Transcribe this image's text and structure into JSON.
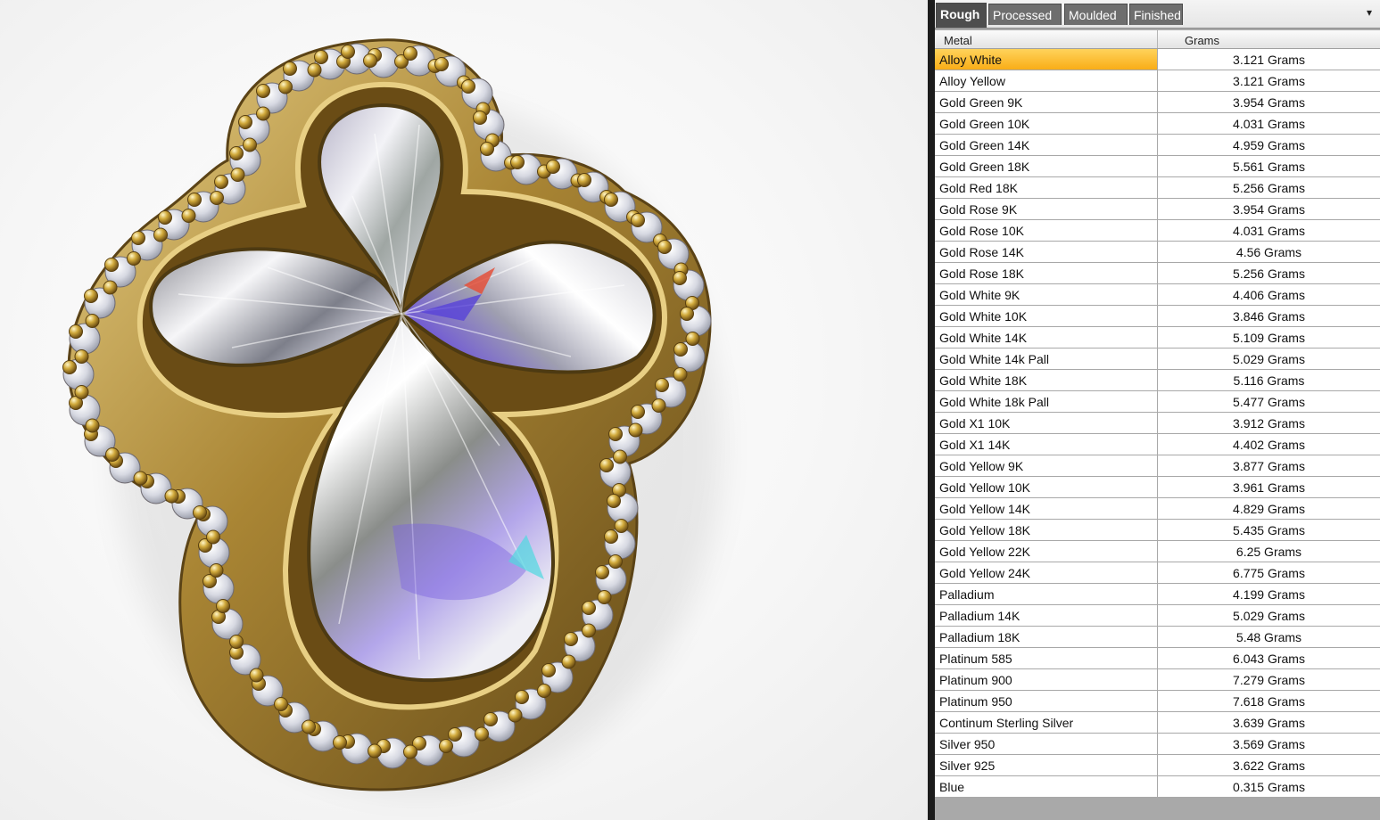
{
  "tabs": [
    {
      "label": "Rough",
      "active": true
    },
    {
      "label": "Processed",
      "active": false
    },
    {
      "label": "Moulded",
      "active": false
    },
    {
      "label": "Finished",
      "active": false
    }
  ],
  "dropdown_icon": "▾",
  "table": {
    "columns": [
      "Metal",
      "Grams"
    ],
    "selected_row": 0,
    "rows": [
      {
        "metal": "Alloy White",
        "grams": "3.121 Grams"
      },
      {
        "metal": "Alloy Yellow",
        "grams": "3.121 Grams"
      },
      {
        "metal": "Gold Green 9K",
        "grams": "3.954 Grams"
      },
      {
        "metal": "Gold Green 10K",
        "grams": "4.031 Grams"
      },
      {
        "metal": "Gold Green 14K",
        "grams": "4.959 Grams"
      },
      {
        "metal": "Gold Green 18K",
        "grams": "5.561 Grams"
      },
      {
        "metal": "Gold Red 18K",
        "grams": "5.256 Grams"
      },
      {
        "metal": "Gold Rose 9K",
        "grams": "3.954 Grams"
      },
      {
        "metal": "Gold Rose 10K",
        "grams": "4.031 Grams"
      },
      {
        "metal": "Gold Rose 14K",
        "grams": "4.56 Grams"
      },
      {
        "metal": "Gold Rose 18K",
        "grams": "5.256 Grams"
      },
      {
        "metal": "Gold White 9K",
        "grams": "4.406 Grams"
      },
      {
        "metal": "Gold White 10K",
        "grams": "3.846 Grams"
      },
      {
        "metal": "Gold White 14K",
        "grams": "5.109 Grams"
      },
      {
        "metal": "Gold White 14k Pall",
        "grams": "5.029 Grams"
      },
      {
        "metal": "Gold White 18K",
        "grams": "5.116 Grams"
      },
      {
        "metal": "Gold White 18k Pall",
        "grams": "5.477 Grams"
      },
      {
        "metal": "Gold X1 10K",
        "grams": "3.912 Grams"
      },
      {
        "metal": "Gold X1 14K",
        "grams": "4.402 Grams"
      },
      {
        "metal": "Gold Yellow 9K",
        "grams": "3.877 Grams"
      },
      {
        "metal": "Gold Yellow 10K",
        "grams": "3.961 Grams"
      },
      {
        "metal": "Gold Yellow 14K",
        "grams": "4.829 Grams"
      },
      {
        "metal": "Gold Yellow 18K",
        "grams": "5.435 Grams"
      },
      {
        "metal": "Gold Yellow 22K",
        "grams": "6.25 Grams"
      },
      {
        "metal": "Gold Yellow 24K",
        "grams": "6.775 Grams"
      },
      {
        "metal": "Palladium",
        "grams": "4.199 Grams"
      },
      {
        "metal": "Palladium 14K",
        "grams": "5.029 Grams"
      },
      {
        "metal": "Palladium 18K",
        "grams": "5.48 Grams"
      },
      {
        "metal": "Platinum 585",
        "grams": "6.043 Grams"
      },
      {
        "metal": "Platinum 900",
        "grams": "7.279 Grams"
      },
      {
        "metal": "Platinum 950",
        "grams": "7.618 Grams"
      },
      {
        "metal": "Continum Sterling Silver",
        "grams": "3.639 Grams"
      },
      {
        "metal": "Silver 950",
        "grams": "3.569 Grams"
      },
      {
        "metal": "Silver 925",
        "grams": "3.622 Grams"
      },
      {
        "metal": "Blue",
        "grams": "0.315 Grams"
      }
    ]
  },
  "colors": {
    "gold": "#b8933a",
    "selection": "#f9ad17",
    "splitter": "#1c1c1c"
  }
}
